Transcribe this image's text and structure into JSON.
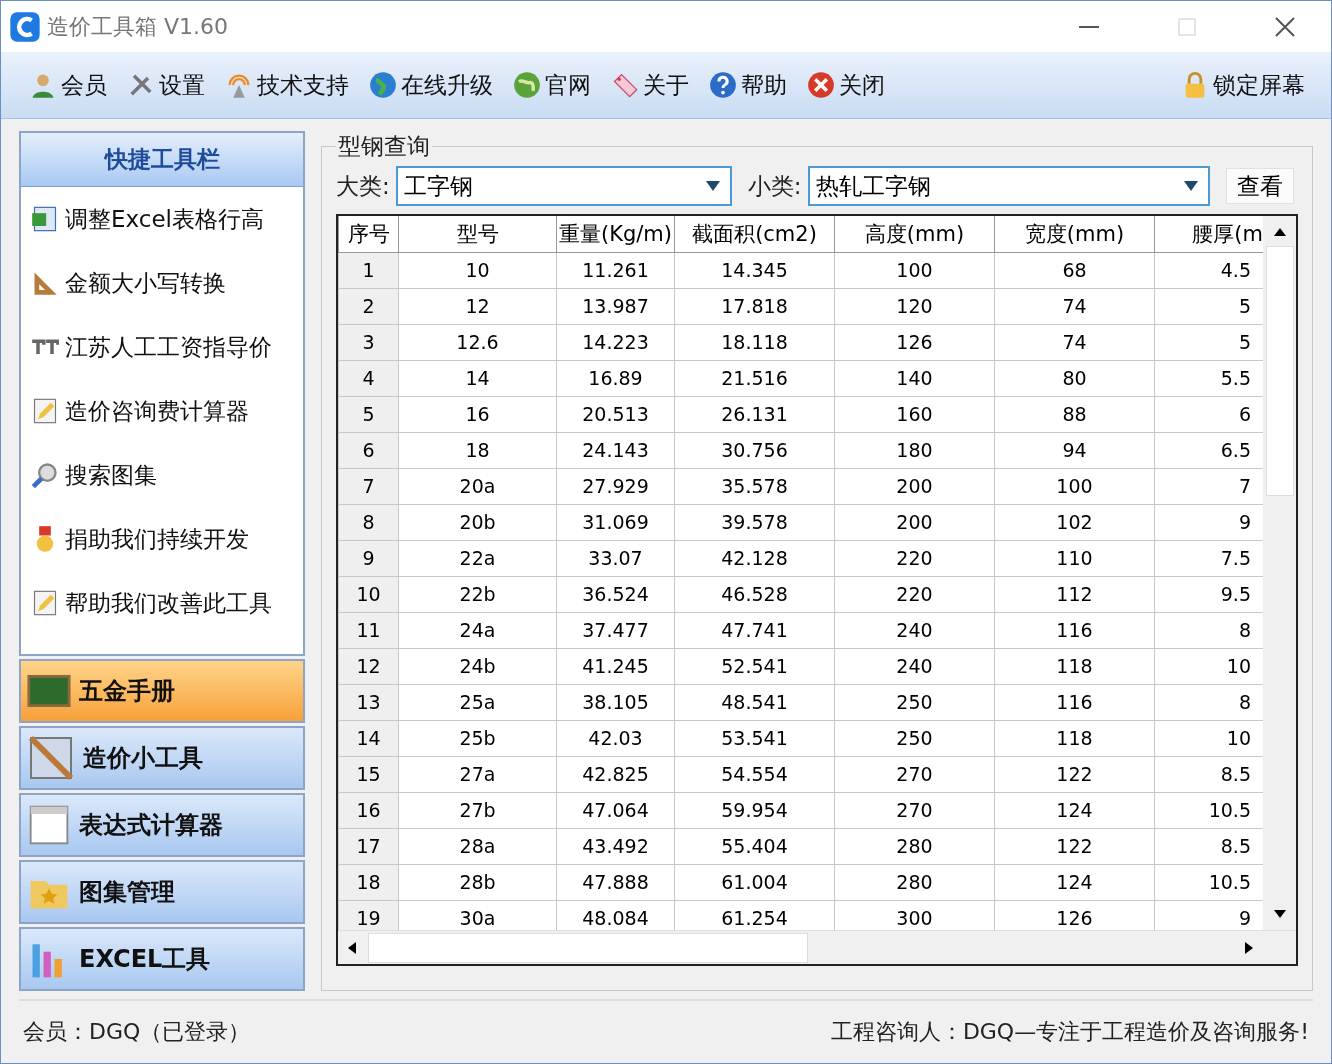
{
  "window": {
    "title": "造价工具箱 V1.60"
  },
  "toolbar": {
    "items": [
      {
        "label": "会员"
      },
      {
        "label": "设置"
      },
      {
        "label": "技术支持"
      },
      {
        "label": "在线升级"
      },
      {
        "label": "官网"
      },
      {
        "label": "关于"
      },
      {
        "label": "帮助"
      },
      {
        "label": "关闭"
      }
    ],
    "lock": {
      "label": "锁定屏幕"
    }
  },
  "quick_panel": {
    "title": "快捷工具栏",
    "items": [
      {
        "label": "调整Excel表格行高"
      },
      {
        "label": "金额大小写转换"
      },
      {
        "label": "江苏人工工资指导价"
      },
      {
        "label": "造价咨询费计算器"
      },
      {
        "label": "搜索图集"
      },
      {
        "label": "捐助我们持续开发"
      },
      {
        "label": "帮助我们改善此工具"
      }
    ]
  },
  "nav": [
    {
      "label": "五金手册",
      "selected": true
    },
    {
      "label": "造价小工具",
      "selected": false
    },
    {
      "label": "表达式计算器",
      "selected": false
    },
    {
      "label": "图集管理",
      "selected": false
    },
    {
      "label": "EXCEL工具",
      "selected": false
    }
  ],
  "query": {
    "title": "型钢查询",
    "category_label": "大类:",
    "category": "工字钢",
    "subcategory_label": "小类:",
    "subcategory": "热轧工字钢",
    "view_button": "查看"
  },
  "table": {
    "columns": [
      "序号",
      "型号",
      "重量(Kg/m)",
      "截面积(cm2)",
      "高度(mm)",
      "宽度(mm)",
      "腰厚(m"
    ],
    "rows": [
      [
        "1",
        "10",
        "11.261",
        "14.345",
        "100",
        "68",
        "4.5"
      ],
      [
        "2",
        "12",
        "13.987",
        "17.818",
        "120",
        "74",
        "5"
      ],
      [
        "3",
        "12.6",
        "14.223",
        "18.118",
        "126",
        "74",
        "5"
      ],
      [
        "4",
        "14",
        "16.89",
        "21.516",
        "140",
        "80",
        "5.5"
      ],
      [
        "5",
        "16",
        "20.513",
        "26.131",
        "160",
        "88",
        "6"
      ],
      [
        "6",
        "18",
        "24.143",
        "30.756",
        "180",
        "94",
        "6.5"
      ],
      [
        "7",
        "20a",
        "27.929",
        "35.578",
        "200",
        "100",
        "7"
      ],
      [
        "8",
        "20b",
        "31.069",
        "39.578",
        "200",
        "102",
        "9"
      ],
      [
        "9",
        "22a",
        "33.07",
        "42.128",
        "220",
        "110",
        "7.5"
      ],
      [
        "10",
        "22b",
        "36.524",
        "46.528",
        "220",
        "112",
        "9.5"
      ],
      [
        "11",
        "24a",
        "37.477",
        "47.741",
        "240",
        "116",
        "8"
      ],
      [
        "12",
        "24b",
        "41.245",
        "52.541",
        "240",
        "118",
        "10"
      ],
      [
        "13",
        "25a",
        "38.105",
        "48.541",
        "250",
        "116",
        "8"
      ],
      [
        "14",
        "25b",
        "42.03",
        "53.541",
        "250",
        "118",
        "10"
      ],
      [
        "15",
        "27a",
        "42.825",
        "54.554",
        "270",
        "122",
        "8.5"
      ],
      [
        "16",
        "27b",
        "47.064",
        "59.954",
        "270",
        "124",
        "10.5"
      ],
      [
        "17",
        "28a",
        "43.492",
        "55.404",
        "280",
        "122",
        "8.5"
      ],
      [
        "18",
        "28b",
        "47.888",
        "61.004",
        "280",
        "124",
        "10.5"
      ],
      [
        "19",
        "30a",
        "48.084",
        "61.254",
        "300",
        "126",
        "9"
      ]
    ]
  },
  "status_bar": {
    "left": "会员：DGQ（已登录）",
    "right": "工程咨询人：DGQ—专注于工程造价及咨询服务!"
  }
}
